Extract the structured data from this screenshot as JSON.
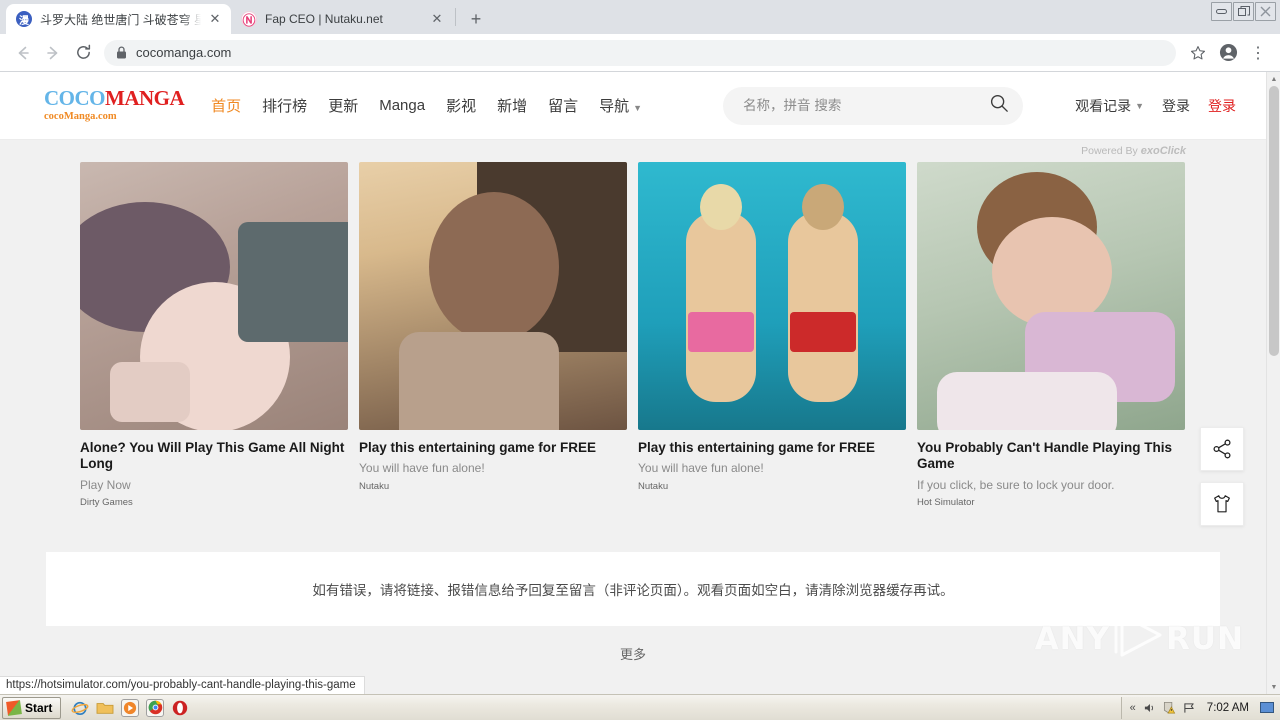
{
  "browser": {
    "tabs": [
      {
        "title": "斗罗大陆 绝世唐门 斗破苍穹 星武神",
        "favicon": "manga-favicon",
        "active": true,
        "close_label": "✕"
      },
      {
        "title": "Fap CEO | Nutaku.net",
        "favicon": "nutaku-favicon",
        "active": false,
        "close_label": "✕"
      }
    ],
    "new_tab_label": "+",
    "window_controls": {
      "minimize": "▭",
      "restore": "❐",
      "close": "✕"
    },
    "nav": {
      "back": "←",
      "forward": "→",
      "reload": "⟳"
    },
    "omnibox": {
      "url": "cocomanga.com",
      "lock_icon": "lock-icon"
    },
    "toolbar_right": {
      "bookmark": "☆",
      "profile": "profile-icon",
      "menu": "⋮"
    },
    "status_url": "https://hotsimulator.com/you-probably-cant-handle-playing-this-game"
  },
  "site": {
    "logo": {
      "part1": "COCO",
      "part2": "MANGA",
      "subtitle": "cocoManga.com"
    },
    "nav": [
      {
        "label": "首页",
        "active": true
      },
      {
        "label": "排行榜",
        "active": false
      },
      {
        "label": "更新",
        "active": false
      },
      {
        "label": "Manga",
        "active": false
      },
      {
        "label": "影视",
        "active": false
      },
      {
        "label": "新增",
        "active": false
      },
      {
        "label": "留言",
        "active": false
      },
      {
        "label": "导航",
        "active": false,
        "caret": "▼"
      }
    ],
    "search": {
      "placeholder": "名称，拼音 搜索",
      "value": "",
      "icon": "search-icon"
    },
    "header_right": [
      {
        "label": "观看记录",
        "caret": "▼",
        "style": "normal"
      },
      {
        "label": "登录",
        "style": "normal"
      },
      {
        "label": "登录",
        "style": "red"
      }
    ],
    "powered_by": {
      "prefix": "Powered By",
      "brand": "exoClick"
    },
    "ads": [
      {
        "title": "Alone? You Will Play This Game All Night Long",
        "desc": "Play Now",
        "brand": "Dirty Games",
        "art": "art1"
      },
      {
        "title": "Play this entertaining game for FREE",
        "desc": "You will have fun alone!",
        "brand": "Nutaku",
        "art": "art2"
      },
      {
        "title": "Play this entertaining game for FREE",
        "desc": "You will have fun alone!",
        "brand": "Nutaku",
        "art": "art3"
      },
      {
        "title": "You Probably Can't Handle Playing This Game",
        "desc": "If you click, be sure to lock your door.",
        "brand": "Hot Simulator",
        "art": "art4"
      }
    ],
    "notice": "如有错误，请将链接、报错信息给予回复至留言（非评论页面）。观看页面如空白，请清除浏览器缓存再试。",
    "more_label": "更多",
    "floaters": [
      {
        "icon": "share-icon"
      },
      {
        "icon": "tshirt-icon"
      }
    ]
  },
  "watermark": {
    "left": "ANY",
    "right": "RUN"
  },
  "taskbar": {
    "start_label": "Start",
    "quick_launch": [
      {
        "icon": "internet-explorer-icon"
      },
      {
        "icon": "file-explorer-icon"
      },
      {
        "icon": "media-player-icon"
      },
      {
        "icon": "chrome-icon"
      },
      {
        "icon": "opera-icon"
      }
    ],
    "tray": {
      "show_hidden": "«",
      "volume": "volume-icon",
      "security": "security-alert-icon",
      "network": "network-icon",
      "time": "7:02 AM",
      "show_desktop": "show-desktop-icon"
    }
  },
  "colors": {
    "accent_orange": "#f08a24",
    "brand_red": "#e02020",
    "logo_blue": "#64b5e8",
    "page_bg": "#f1f1f1"
  }
}
